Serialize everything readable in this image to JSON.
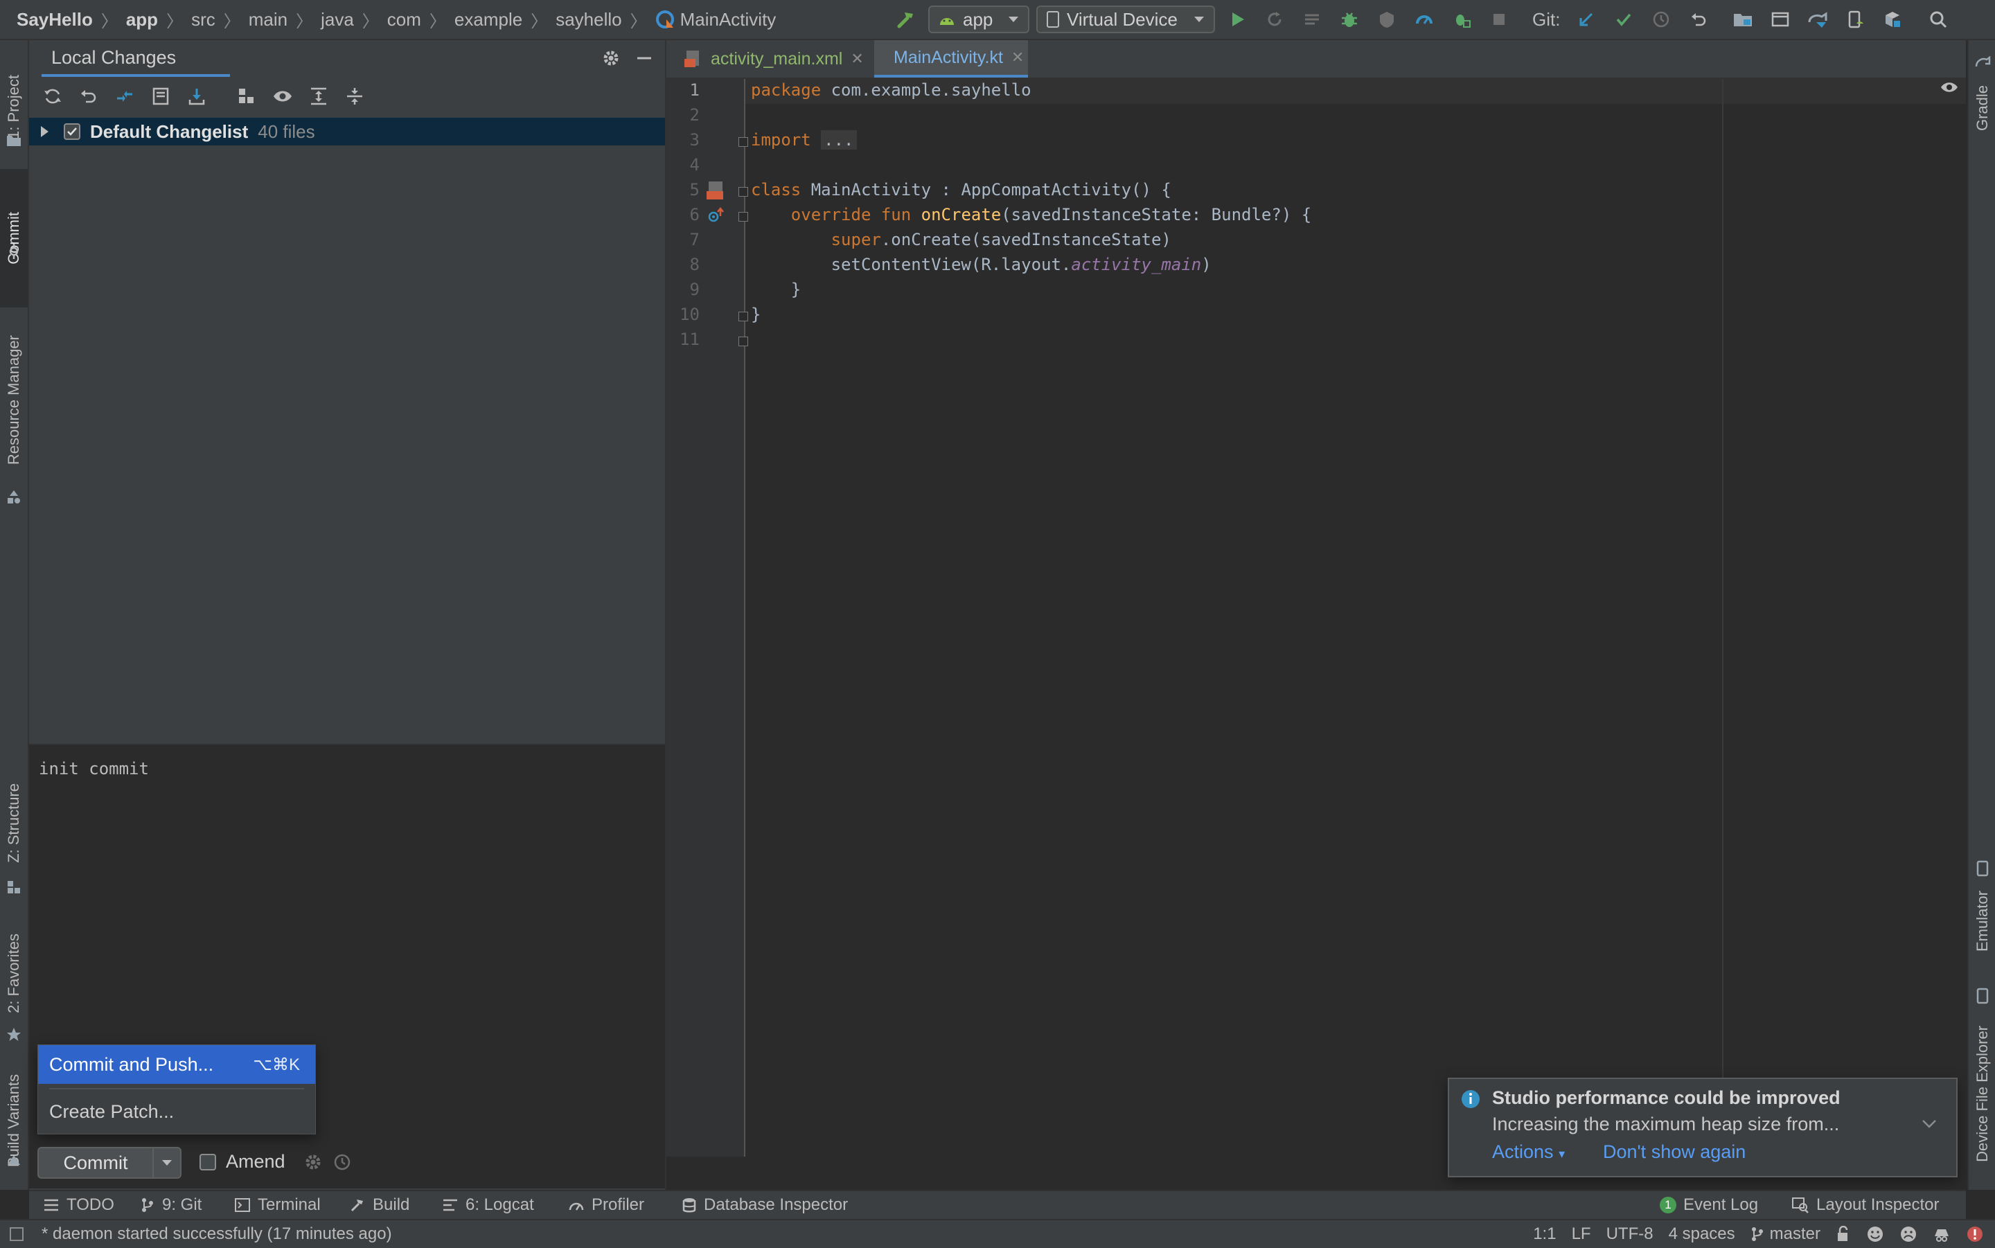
{
  "breadcrumbs": [
    {
      "label": "SayHello",
      "bold": true
    },
    {
      "label": "app",
      "bold": true
    },
    {
      "label": "src"
    },
    {
      "label": "main"
    },
    {
      "label": "java"
    },
    {
      "label": "com"
    },
    {
      "label": "example"
    },
    {
      "label": "sayhello"
    },
    {
      "label": "MainActivity"
    }
  ],
  "toolbar": {
    "run_config": "app",
    "device": "Virtual Device",
    "git_label": "Git:"
  },
  "left_strip": {
    "project": "1: Project",
    "commit": "Commit",
    "resource_manager": "Resource Manager",
    "structure": "Z: Structure",
    "favorites": "2: Favorites",
    "build_variants": "Build Variants"
  },
  "right_strip": {
    "gradle": "Gradle",
    "emulator": "Emulator",
    "device_file_explorer": "Device File Explorer"
  },
  "commit_panel": {
    "title": "Local Changes",
    "changelist_name": "Default Changelist",
    "changelist_count": "40 files",
    "commit_message": "init commit",
    "commit_button": "Commit",
    "amend_label": "Amend"
  },
  "commit_menu": {
    "commit_and_push": "Commit and Push...",
    "commit_and_push_shortcut": "⌥⌘K",
    "create_patch": "Create Patch..."
  },
  "editor": {
    "tabs": [
      {
        "label": "activity_main.xml",
        "active": false
      },
      {
        "label": "MainActivity.kt",
        "active": true
      }
    ],
    "line_numbers": [
      "1",
      "2",
      "3",
      "4",
      "5",
      "6",
      "7",
      "8",
      "9",
      "10",
      "11"
    ],
    "code": {
      "l1_kw": "package",
      "l1_rest": " com.example.sayhello",
      "l3_kw": "import",
      "l3_fold": "...",
      "l6_kw": "class",
      "l6_rest": " MainActivity : AppCompatActivity() {",
      "l7_kw": "override fun",
      "l7_fn": "onCreate",
      "l7_rest": "(savedInstanceState: Bundle?) {",
      "l8_kw": "super",
      "l8_rest": ".onCreate(savedInstanceState)",
      "l9_pre": "setContentView(R.layout.",
      "l9_it": "activity_main",
      "l9_post": ")",
      "l10": "}",
      "l11": "}"
    }
  },
  "notification": {
    "title": "Studio performance could be improved",
    "body": "Increasing the maximum heap size from...",
    "actions": "Actions",
    "dismiss": "Don't show again"
  },
  "bottom_tabs": {
    "todo": "TODO",
    "git": "9: Git",
    "terminal": "Terminal",
    "build": "Build",
    "logcat": "6: Logcat",
    "profiler": "Profiler",
    "database": "Database Inspector",
    "event_log": "Event Log",
    "event_log_count": "1",
    "layout_inspector": "Layout Inspector"
  },
  "status": {
    "message": "* daemon started successfully (17 minutes ago)",
    "position": "1:1",
    "line_sep": "LF",
    "encoding": "UTF-8",
    "indent": "4 spaces",
    "branch": "master"
  },
  "colors": {
    "accent": "#4a88c7",
    "selection": "#2f65ca",
    "keyword": "#cc7832",
    "function": "#ffc66d",
    "link": "#589df6"
  }
}
